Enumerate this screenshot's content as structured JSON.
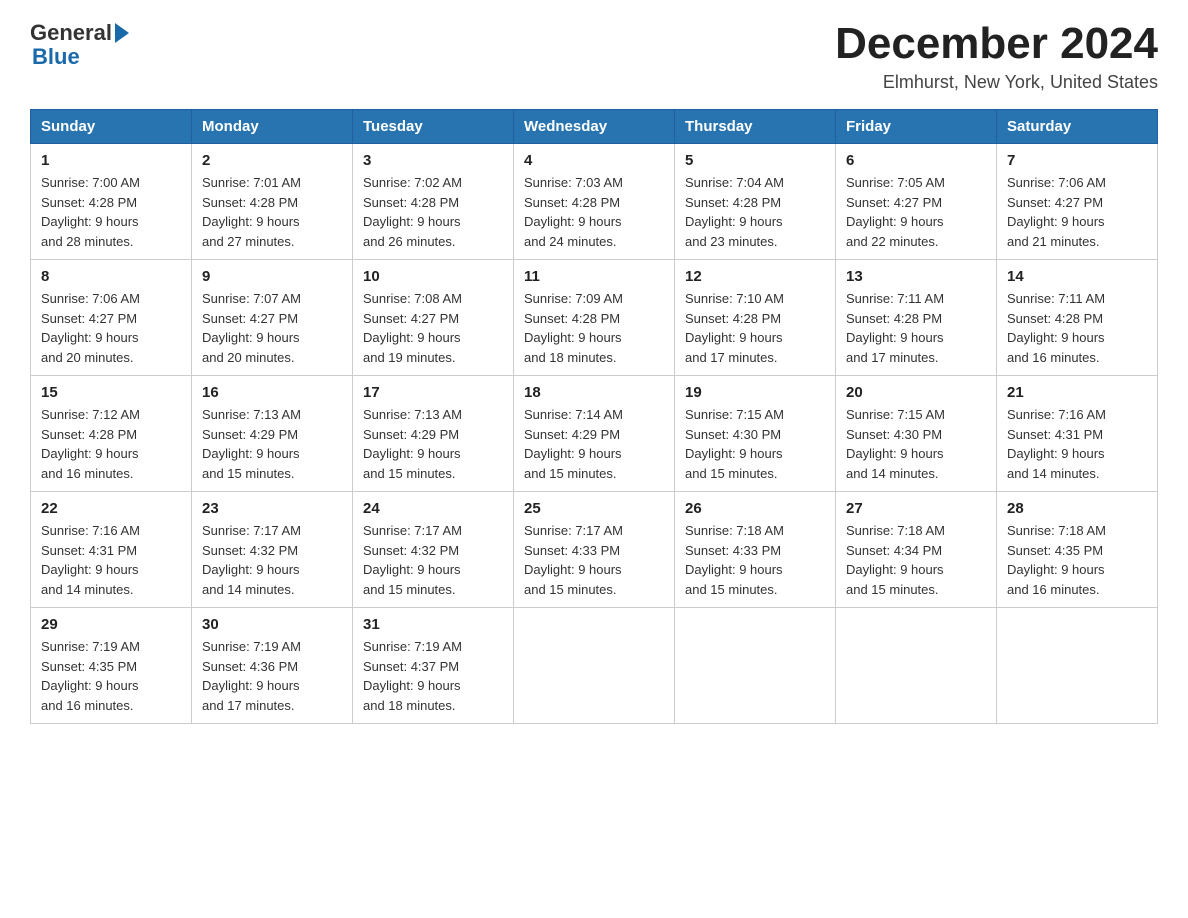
{
  "header": {
    "title": "December 2024",
    "subtitle": "Elmhurst, New York, United States"
  },
  "logo": {
    "general": "General",
    "blue": "Blue"
  },
  "days_of_week": [
    "Sunday",
    "Monday",
    "Tuesday",
    "Wednesday",
    "Thursday",
    "Friday",
    "Saturday"
  ],
  "weeks": [
    [
      {
        "day": "1",
        "sunrise": "7:00 AM",
        "sunset": "4:28 PM",
        "daylight": "9 hours and 28 minutes."
      },
      {
        "day": "2",
        "sunrise": "7:01 AM",
        "sunset": "4:28 PM",
        "daylight": "9 hours and 27 minutes."
      },
      {
        "day": "3",
        "sunrise": "7:02 AM",
        "sunset": "4:28 PM",
        "daylight": "9 hours and 26 minutes."
      },
      {
        "day": "4",
        "sunrise": "7:03 AM",
        "sunset": "4:28 PM",
        "daylight": "9 hours and 24 minutes."
      },
      {
        "day": "5",
        "sunrise": "7:04 AM",
        "sunset": "4:28 PM",
        "daylight": "9 hours and 23 minutes."
      },
      {
        "day": "6",
        "sunrise": "7:05 AM",
        "sunset": "4:27 PM",
        "daylight": "9 hours and 22 minutes."
      },
      {
        "day": "7",
        "sunrise": "7:06 AM",
        "sunset": "4:27 PM",
        "daylight": "9 hours and 21 minutes."
      }
    ],
    [
      {
        "day": "8",
        "sunrise": "7:06 AM",
        "sunset": "4:27 PM",
        "daylight": "9 hours and 20 minutes."
      },
      {
        "day": "9",
        "sunrise": "7:07 AM",
        "sunset": "4:27 PM",
        "daylight": "9 hours and 20 minutes."
      },
      {
        "day": "10",
        "sunrise": "7:08 AM",
        "sunset": "4:27 PM",
        "daylight": "9 hours and 19 minutes."
      },
      {
        "day": "11",
        "sunrise": "7:09 AM",
        "sunset": "4:28 PM",
        "daylight": "9 hours and 18 minutes."
      },
      {
        "day": "12",
        "sunrise": "7:10 AM",
        "sunset": "4:28 PM",
        "daylight": "9 hours and 17 minutes."
      },
      {
        "day": "13",
        "sunrise": "7:11 AM",
        "sunset": "4:28 PM",
        "daylight": "9 hours and 17 minutes."
      },
      {
        "day": "14",
        "sunrise": "7:11 AM",
        "sunset": "4:28 PM",
        "daylight": "9 hours and 16 minutes."
      }
    ],
    [
      {
        "day": "15",
        "sunrise": "7:12 AM",
        "sunset": "4:28 PM",
        "daylight": "9 hours and 16 minutes."
      },
      {
        "day": "16",
        "sunrise": "7:13 AM",
        "sunset": "4:29 PM",
        "daylight": "9 hours and 15 minutes."
      },
      {
        "day": "17",
        "sunrise": "7:13 AM",
        "sunset": "4:29 PM",
        "daylight": "9 hours and 15 minutes."
      },
      {
        "day": "18",
        "sunrise": "7:14 AM",
        "sunset": "4:29 PM",
        "daylight": "9 hours and 15 minutes."
      },
      {
        "day": "19",
        "sunrise": "7:15 AM",
        "sunset": "4:30 PM",
        "daylight": "9 hours and 15 minutes."
      },
      {
        "day": "20",
        "sunrise": "7:15 AM",
        "sunset": "4:30 PM",
        "daylight": "9 hours and 14 minutes."
      },
      {
        "day": "21",
        "sunrise": "7:16 AM",
        "sunset": "4:31 PM",
        "daylight": "9 hours and 14 minutes."
      }
    ],
    [
      {
        "day": "22",
        "sunrise": "7:16 AM",
        "sunset": "4:31 PM",
        "daylight": "9 hours and 14 minutes."
      },
      {
        "day": "23",
        "sunrise": "7:17 AM",
        "sunset": "4:32 PM",
        "daylight": "9 hours and 14 minutes."
      },
      {
        "day": "24",
        "sunrise": "7:17 AM",
        "sunset": "4:32 PM",
        "daylight": "9 hours and 15 minutes."
      },
      {
        "day": "25",
        "sunrise": "7:17 AM",
        "sunset": "4:33 PM",
        "daylight": "9 hours and 15 minutes."
      },
      {
        "day": "26",
        "sunrise": "7:18 AM",
        "sunset": "4:33 PM",
        "daylight": "9 hours and 15 minutes."
      },
      {
        "day": "27",
        "sunrise": "7:18 AM",
        "sunset": "4:34 PM",
        "daylight": "9 hours and 15 minutes."
      },
      {
        "day": "28",
        "sunrise": "7:18 AM",
        "sunset": "4:35 PM",
        "daylight": "9 hours and 16 minutes."
      }
    ],
    [
      {
        "day": "29",
        "sunrise": "7:19 AM",
        "sunset": "4:35 PM",
        "daylight": "9 hours and 16 minutes."
      },
      {
        "day": "30",
        "sunrise": "7:19 AM",
        "sunset": "4:36 PM",
        "daylight": "9 hours and 17 minutes."
      },
      {
        "day": "31",
        "sunrise": "7:19 AM",
        "sunset": "4:37 PM",
        "daylight": "9 hours and 18 minutes."
      },
      null,
      null,
      null,
      null
    ]
  ],
  "labels": {
    "sunrise": "Sunrise:",
    "sunset": "Sunset:",
    "daylight": "Daylight:"
  }
}
